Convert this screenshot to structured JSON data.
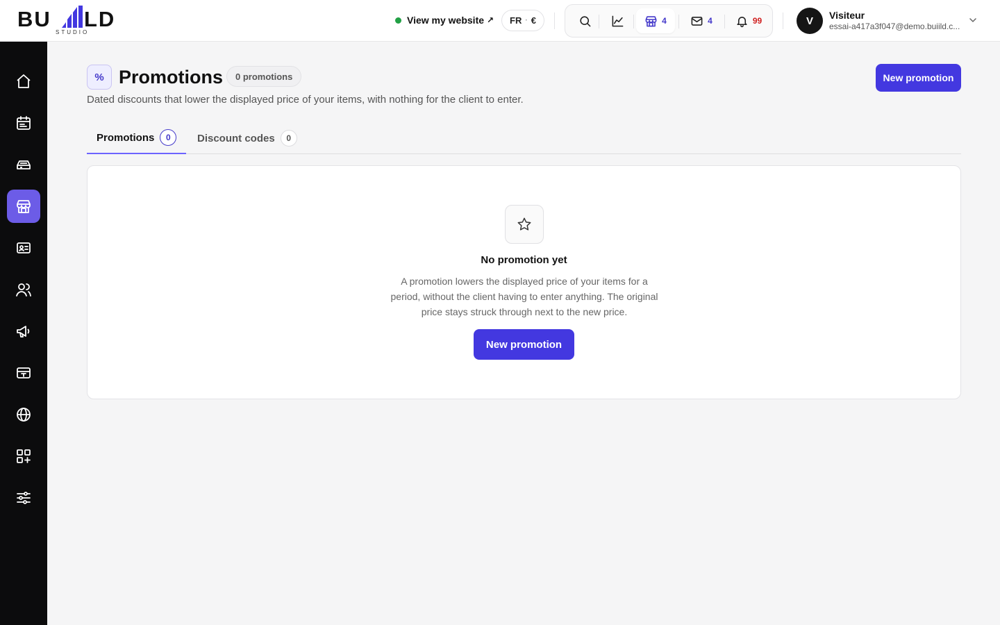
{
  "brand": {
    "logo_left": "BU",
    "logo_right": "LD",
    "logo_sub": "STUDIO"
  },
  "header": {
    "view_site_label": "View my website",
    "view_site_arrow": "↗",
    "locale_lang": "FR",
    "locale_currency": "€",
    "store_count": "4",
    "mail_count": "4",
    "notif_count": "99",
    "user": {
      "initial": "V",
      "name": "Visiteur",
      "email": "essai-a417a3f047@demo.buiild.c..."
    }
  },
  "sidebar": {
    "items": [
      {
        "name": "home-icon"
      },
      {
        "name": "calendar-icon"
      },
      {
        "name": "inbox-tray-icon"
      },
      {
        "name": "store-icon",
        "active": true
      },
      {
        "name": "contact-card-icon"
      },
      {
        "name": "users-icon"
      },
      {
        "name": "megaphone-icon"
      },
      {
        "name": "payment-card-icon"
      },
      {
        "name": "globe-icon"
      },
      {
        "name": "apps-add-icon"
      },
      {
        "name": "sliders-icon"
      }
    ]
  },
  "page": {
    "icon_glyph": "%",
    "title": "Promotions",
    "count_label": "0 promotions",
    "subtitle": "Dated discounts that lower the displayed price of your items, with nothing for the client to enter.",
    "new_button": "New promotion"
  },
  "tabs": [
    {
      "label": "Promotions",
      "count": "0",
      "active": true
    },
    {
      "label": "Discount codes",
      "count": "0",
      "active": false
    }
  ],
  "empty_state": {
    "title": "No promotion yet",
    "description": "A promotion lowers the displayed price of your items for a period, without the client having to enter anything. The original price stays struck through next to the new price.",
    "button": "New promotion"
  },
  "colors": {
    "accent": "#4338e0",
    "sidebar_bg": "#0c0c0d",
    "sidebar_active": "#6c5ce7",
    "online_dot": "#22a045",
    "notif_red": "#d02020"
  }
}
